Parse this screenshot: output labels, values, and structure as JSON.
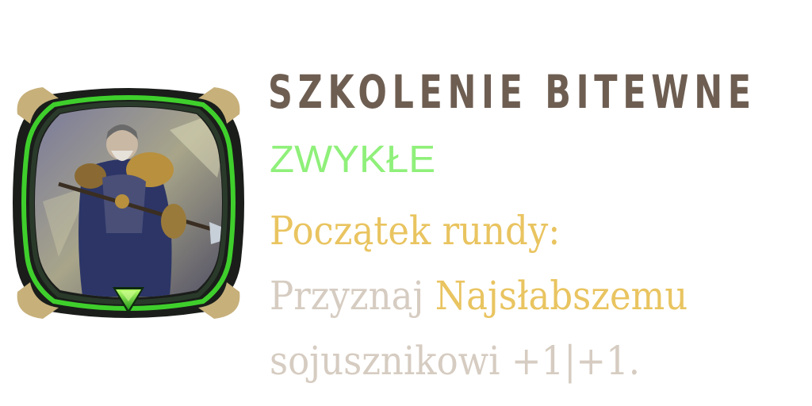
{
  "card": {
    "title": "SZKOLENIE BITEWNE",
    "rarity": "ZWYKŁE",
    "trigger": "Początek rundy:",
    "ability_part1": "Przyznaj ",
    "ability_keyword": "Najsłabszemu",
    "ability_part2": "sojusznikowi +1|+1."
  },
  "icons": {
    "portrait": "knight-with-spear-portrait",
    "rarity_gem": "green-triangle-gem-icon"
  },
  "colors": {
    "title": "#6e5e52",
    "rarity": "#8ff07a",
    "keyword": "#e9c460",
    "body_text": "#d6ccc1",
    "frame_green": "#3fcf2c"
  }
}
